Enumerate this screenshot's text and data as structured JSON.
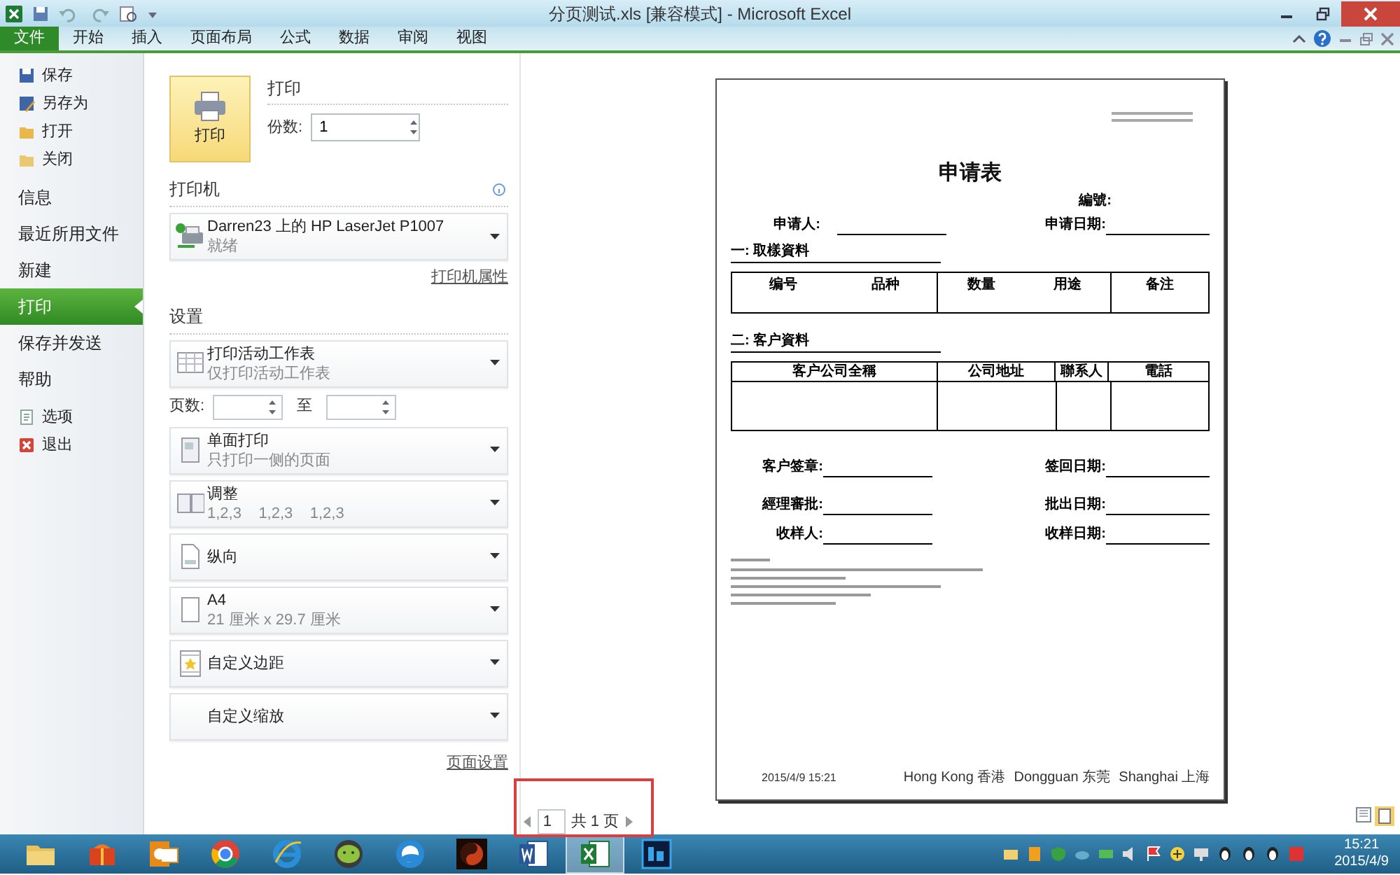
{
  "window": {
    "title": "分页测试.xls  [兼容模式] - Microsoft Excel"
  },
  "ribbon_tabs": [
    {
      "label": "文件",
      "selected": true
    },
    {
      "label": "开始",
      "selected": false
    },
    {
      "label": "插入",
      "selected": false
    },
    {
      "label": "页面布局",
      "selected": false
    },
    {
      "label": "公式",
      "selected": false
    },
    {
      "label": "数据",
      "selected": false
    },
    {
      "label": "审阅",
      "selected": false
    },
    {
      "label": "视图",
      "selected": false
    }
  ],
  "backstage_menu": [
    {
      "label": "保存",
      "kind": "command",
      "selected": false
    },
    {
      "label": "另存为",
      "kind": "command",
      "selected": false
    },
    {
      "label": "打开",
      "kind": "command",
      "selected": false
    },
    {
      "label": "关闭",
      "kind": "command",
      "selected": false
    },
    {
      "label": "信息",
      "kind": "page",
      "selected": false
    },
    {
      "label": "最近所用文件",
      "kind": "page",
      "selected": false
    },
    {
      "label": "新建",
      "kind": "page",
      "selected": false
    },
    {
      "label": "打印",
      "kind": "page",
      "selected": true
    },
    {
      "label": "保存并发送",
      "kind": "page",
      "selected": false
    },
    {
      "label": "帮助",
      "kind": "page",
      "selected": false
    },
    {
      "label": "选项",
      "kind": "command",
      "selected": false
    },
    {
      "label": "退出",
      "kind": "command",
      "selected": false
    }
  ],
  "print": {
    "button": "打印",
    "heading": "打印",
    "copies_label": "份数:",
    "copies": "1"
  },
  "printer": {
    "heading": "打印机",
    "name": "Darren23 上的 HP LaserJet P1007",
    "status": "就绪",
    "properties_link": "打印机属性"
  },
  "settings": {
    "heading": "设置",
    "page_setup_link": "页面设置",
    "options": [
      {
        "kind": "dropdown",
        "title": "打印活动工作表",
        "subtitle": "仅打印活动工作表"
      },
      {
        "kind": "page_range",
        "label": "页数:",
        "to_label": "至"
      },
      {
        "kind": "dropdown",
        "title": "单面打印",
        "subtitle": "只打印一侧的页面"
      },
      {
        "kind": "dropdown",
        "title": "调整",
        "subtitle": "1,2,3    1,2,3    1,2,3"
      },
      {
        "kind": "dropdown",
        "title": "纵向"
      },
      {
        "kind": "dropdown",
        "title": "A4",
        "subtitle": "21 厘米 x 29.7 厘米"
      },
      {
        "kind": "dropdown",
        "title": "自定义边距"
      },
      {
        "kind": "dropdown",
        "title": "自定义缩放"
      }
    ]
  },
  "preview": {
    "title": "申请表",
    "number_label": "編號:",
    "applicant_label": "申请人:",
    "date_label": "申请日期:",
    "section_1": "一: 取樣資料",
    "table_1": [
      [
        "编号",
        "品种"
      ],
      [
        "数量",
        "用途"
      ],
      [
        "备注"
      ]
    ],
    "section_2": "二: 客户資料",
    "table_2": [
      "客户公司全稱",
      "公司地址",
      "聯系人",
      "電話"
    ],
    "signatures": [
      {
        "left": "客户签章:",
        "right": "签回日期:"
      },
      {
        "left": "經理審批:",
        "right": "批出日期:"
      },
      {
        "left": "收样人:",
        "right": "收样日期:"
      }
    ],
    "footer_date": "2015/4/9 15:21",
    "footer_offices": [
      "Hong Kong 香港",
      "Dongguan 东莞",
      "Shanghai 上海"
    ]
  },
  "page_nav": {
    "current": "1",
    "total": "共 1 页"
  },
  "taskbar": {
    "apps": [
      {
        "selected": false
      },
      {
        "selected": false
      },
      {
        "selected": false
      },
      {
        "selected": false
      },
      {
        "selected": false
      },
      {
        "selected": false
      },
      {
        "selected": false
      },
      {
        "selected": false
      },
      {
        "selected": false
      },
      {
        "selected": true
      },
      {
        "selected": false
      }
    ],
    "time": "15:21",
    "date": "2015/4/9"
  }
}
